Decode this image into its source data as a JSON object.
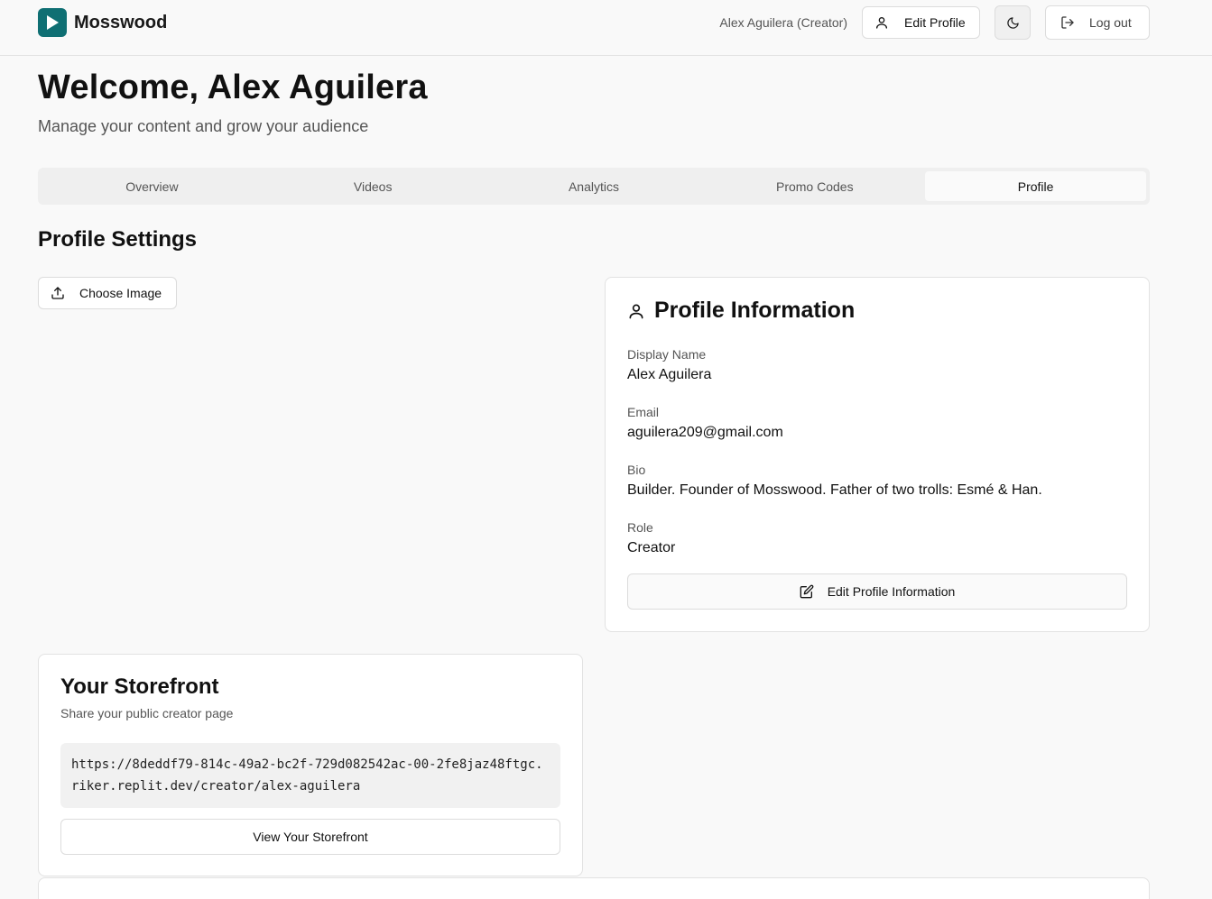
{
  "app": {
    "name": "Mosswood",
    "brand_color": "#0f6f73"
  },
  "header": {
    "user_label": "Alex Aguilera (Creator)",
    "edit_profile_label": "Edit Profile",
    "logout_label": "Log out"
  },
  "page": {
    "welcome": "Welcome, Alex Aguilera",
    "subtitle": "Manage your content and grow your audience"
  },
  "tabs": [
    {
      "label": "Overview"
    },
    {
      "label": "Videos"
    },
    {
      "label": "Analytics"
    },
    {
      "label": "Promo Codes"
    },
    {
      "label": "Profile",
      "active": true
    }
  ],
  "profile_settings": {
    "title": "Profile Settings",
    "choose_image_label": "Choose Image"
  },
  "profile_info": {
    "title": "Profile Information",
    "fields": [
      {
        "label": "Display Name",
        "value": "Alex Aguilera"
      },
      {
        "label": "Email",
        "value": "aguilera209@gmail.com"
      },
      {
        "label": "Bio",
        "value": "Builder. Founder of Mosswood. Father of two trolls: Esmé & Han."
      },
      {
        "label": "Role",
        "value": "Creator"
      }
    ],
    "edit_button_label": "Edit Profile Information"
  },
  "storefront": {
    "title": "Your Storefront",
    "subtitle": "Share your public creator page",
    "url": "https://8deddf79-814c-49a2-bc2f-729d082542ac-00-2fe8jaz48ftgc.riker.replit.dev/creator/alex-aguilera",
    "view_button_label": "View Your Storefront"
  }
}
